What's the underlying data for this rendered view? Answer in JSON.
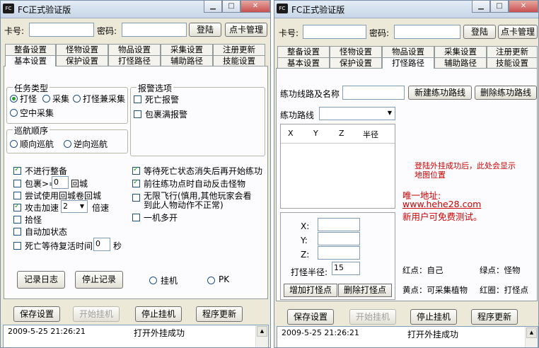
{
  "app": {
    "title": "FC正式验证版",
    "icon_text": "FC"
  },
  "login": {
    "card_label": "卡号:",
    "password_label": "密码:",
    "login_button": "登陆",
    "card_manage_button": "点卡管理"
  },
  "tabs": {
    "row1": [
      "整备设置",
      "怪物设置",
      "物品设置",
      "采集设置",
      "注册更新"
    ],
    "row2": [
      "基本设置",
      "保护设置",
      "打怪路径",
      "辅助路径",
      "技能设置"
    ]
  },
  "basic": {
    "task_type": {
      "title": "任务类型",
      "options": [
        "打怪",
        "采集",
        "打怪兼采集",
        "空中采集"
      ],
      "selected": "打怪"
    },
    "patrol": {
      "title": "巡航顺序",
      "options": [
        "顺向巡航",
        "逆向巡航"
      ]
    },
    "alarm": {
      "title": "报警选项",
      "options": [
        "死亡报警",
        "包裹满报警"
      ]
    },
    "left_checks": {
      "no_prepare": "不进行整备",
      "bag_label": "包裹>=",
      "bag_value": "0",
      "bag_suffix": "回城",
      "use_scroll": "尝试使用回城卷回城",
      "attack_speed": "攻击加速",
      "attack_speed_value": "2",
      "attack_speed_suffix": "倍速",
      "pickup": "拾怪",
      "auto_buff": "自动加状态",
      "revive_label": "死亡等待复活时间",
      "revive_value": "0",
      "revive_suffix": "秒"
    },
    "right_checks": {
      "wait_death": "等待死亡状态消失后再开始练功",
      "counter_attack": "前往练功点时自动反击怪物",
      "fly_line1": "无限飞行(慎用,其他玩家会看",
      "fly_line2": "到此人物动作不正常)",
      "multi": "一机多开"
    },
    "buttons": {
      "log": "记录日志",
      "stop_log": "停止记录"
    },
    "radios": {
      "idle": "挂机",
      "pk": "PK"
    }
  },
  "path": {
    "route_label": "练功线路及名称",
    "new_route_button": "新建练功路线",
    "delete_route_button": "删除练功路线",
    "route_select_label": "练功路线",
    "columns": [
      "X",
      "Y",
      "Z",
      "半径"
    ],
    "map_hint_line1": "登陆外挂成功后，此处会显示",
    "map_hint_line2": "地图位置",
    "site_label": "唯一地址:",
    "site_url": "www.hehe28.com",
    "trial_text": "新用户可免费测试。",
    "x_label": "X:",
    "y_label": "Y:",
    "z_label": "Z:",
    "radius_label": "打怪半径:",
    "radius_value": "15",
    "add_point_button": "增加打怪点",
    "delete_point_button": "删除打怪点",
    "legend": {
      "red": "红点：自己",
      "green": "绿点：怪物",
      "yellow": "黄点：可采集植物",
      "red_circle": "红圈：打怪点"
    }
  },
  "bottom": {
    "save": "保存设置",
    "start": "开始挂机",
    "stop": "停止挂机",
    "update": "程序更新"
  },
  "log": {
    "time": "2009-5-25 21:26:21",
    "message": "打开外挂成功"
  }
}
